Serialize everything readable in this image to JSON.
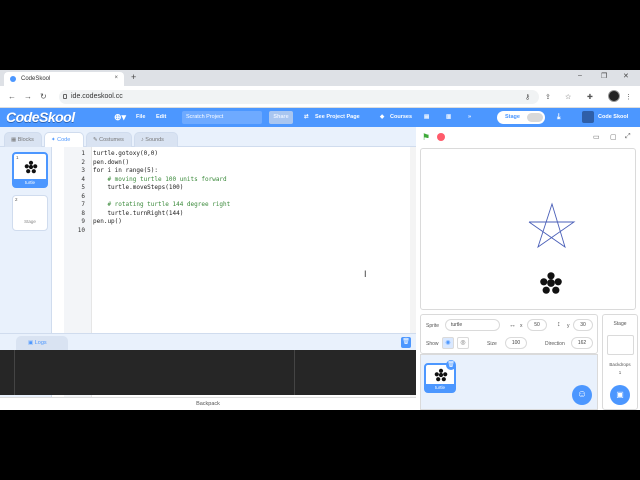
{
  "browser": {
    "tab_title": "CodeSkool",
    "tab_close": "×",
    "new_tab": "+",
    "url": "ide.codeskool.cc",
    "win_min": "–",
    "win_max": "❐",
    "win_close": "✕"
  },
  "menubar": {
    "logo": "CodeSkool",
    "file": "File",
    "edit": "Edit",
    "project_title": "Scratch Project",
    "share": "Share",
    "see_project_page": "See Project Page",
    "courses": "Courses",
    "stage_toggle": "Stage",
    "user": "Code Skool"
  },
  "editor_tabs": {
    "blocks": "Blocks",
    "code": "Code",
    "costumes": "Costumes",
    "sounds": "Sounds"
  },
  "sprite_list": [
    {
      "number": "1",
      "name": "turtle"
    },
    {
      "number": "2",
      "name": "Stage"
    }
  ],
  "code": {
    "line_numbers": [
      "1",
      "2",
      "3",
      "4",
      "5",
      "6",
      "7",
      "8",
      "9",
      "10"
    ],
    "lines": [
      "turtle.gotoxy(0,0)",
      "pen.down()",
      "for i in range(5):",
      "    # moving turtle 100 units forward",
      "    turtle.moveSteps(100)",
      "",
      "    # rotating turtle 144 degree right",
      "    turtle.turnRight(144)",
      "pen.up()",
      ""
    ]
  },
  "logs": {
    "tab": "Logs"
  },
  "backpack": "Backpack",
  "sprite_info": {
    "sprite_label": "Sprite",
    "sprite_name": "turtle",
    "x_label": "x",
    "x_value": "50",
    "y_label": "y",
    "y_value": "30",
    "show_label": "Show",
    "size_label": "Size",
    "size_value": "100",
    "direction_label": "Direction",
    "direction_value": "162"
  },
  "sprite_tile": {
    "name": "turtle"
  },
  "stage_panel": {
    "title": "Stage",
    "backdrops_label": "Backdrops",
    "backdrops_count": "1"
  },
  "colors": {
    "brand_blue": "#4c97ff",
    "flag_green": "#3faa3a",
    "stop_red": "#ff5b6b",
    "comment_green": "#3a8a3a"
  }
}
